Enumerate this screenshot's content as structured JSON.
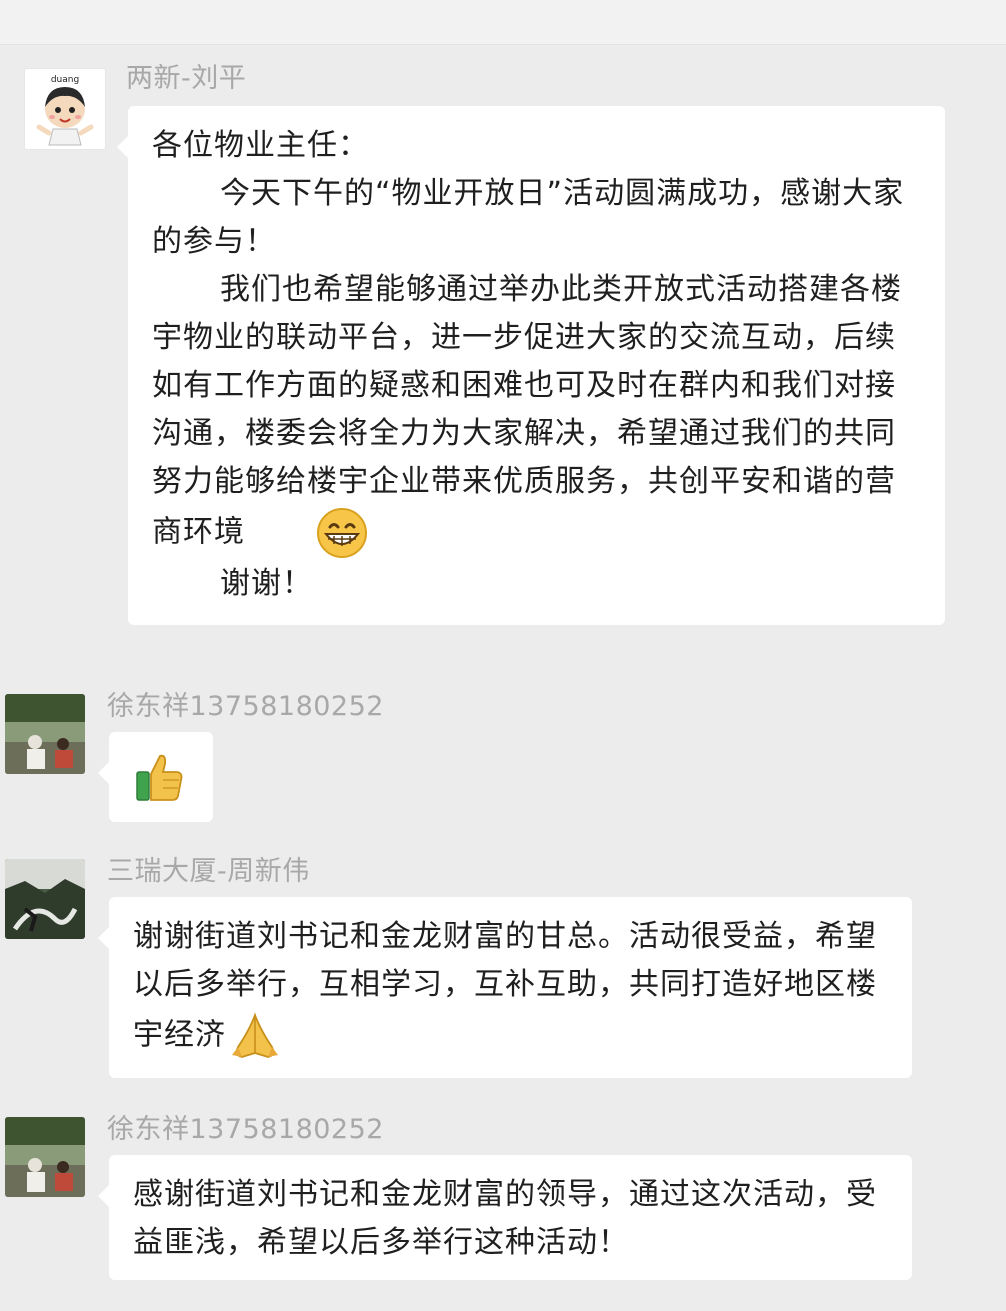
{
  "messages": [
    {
      "sender": "两新-刘平",
      "paragraphs": [
        "各位物业主任：",
        "今天下午的“物业开放日”活动圆满成功，感谢大家的参与！",
        "我们也希望能够通过举办此类开放式活动搭建各楼宇物业的联动平台，进一步促进大家的交流互动，后续如有工作方面的疑惑和困难也可及时在群内和我们对接沟通，楼委会将全力为大家解决，希望通过我们的共同努力能够给楼宇企业带来优质服务，共创平安和谐的营商环境",
        "谢谢！"
      ],
      "inline_emoji": "grin-emoji",
      "avatar_label": "duang"
    },
    {
      "sender": "徐东祥13758180252",
      "emoji": "thumbs-up-emoji"
    },
    {
      "sender": "三瑞大厦-周新伟",
      "text": "谢谢街道刘书记和金龙财富的甘总。活动很受益，希望以后多举行，互相学习，互补互助，共同打造好地区楼宇经济",
      "inline_emoji": "praying-hands-emoji"
    },
    {
      "sender": "徐东祥13758180252",
      "text": "感谢街道刘书记和金龙财富的领导，通过这次活动，受益匪浅，希望以后多举行这种活动！"
    }
  ],
  "colors": {
    "background": "#ececec",
    "bubble": "#ffffff",
    "sender_name": "#a8a8a8",
    "text": "#1f1f1f"
  }
}
